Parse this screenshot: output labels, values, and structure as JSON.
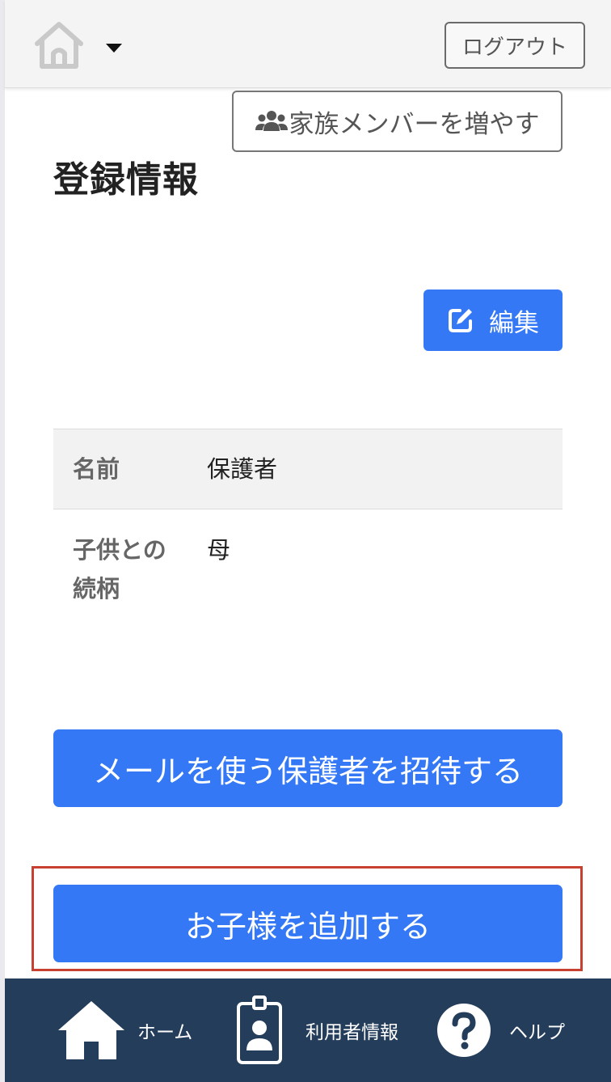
{
  "header": {
    "home_icon": "home-outline-icon",
    "dropdown_icon": "caret-down-icon",
    "logout_label": "ログアウト"
  },
  "main": {
    "add_family_label": "家族メンバーを増やす",
    "add_family_icon": "users-icon",
    "title": "登録情報",
    "edit_label": "編集",
    "edit_icon": "edit-icon",
    "info_rows": [
      {
        "label": "名前",
        "value": "保護者"
      },
      {
        "label_line1": "子供との",
        "label_line2": "続柄",
        "value": "母"
      }
    ],
    "invite_label": "メールを使う保護者を招待する",
    "add_child_label": "お子様を追加する"
  },
  "bottom_nav": {
    "items": [
      {
        "label": "ホーム",
        "icon": "home-icon"
      },
      {
        "label": "利用者情報",
        "icon": "id-badge-icon"
      },
      {
        "label": "ヘルプ",
        "icon": "question-circle-icon"
      }
    ]
  },
  "colors": {
    "primary": "#3478f6",
    "nav_bg": "#243d5b",
    "highlight": "#c8402f"
  }
}
